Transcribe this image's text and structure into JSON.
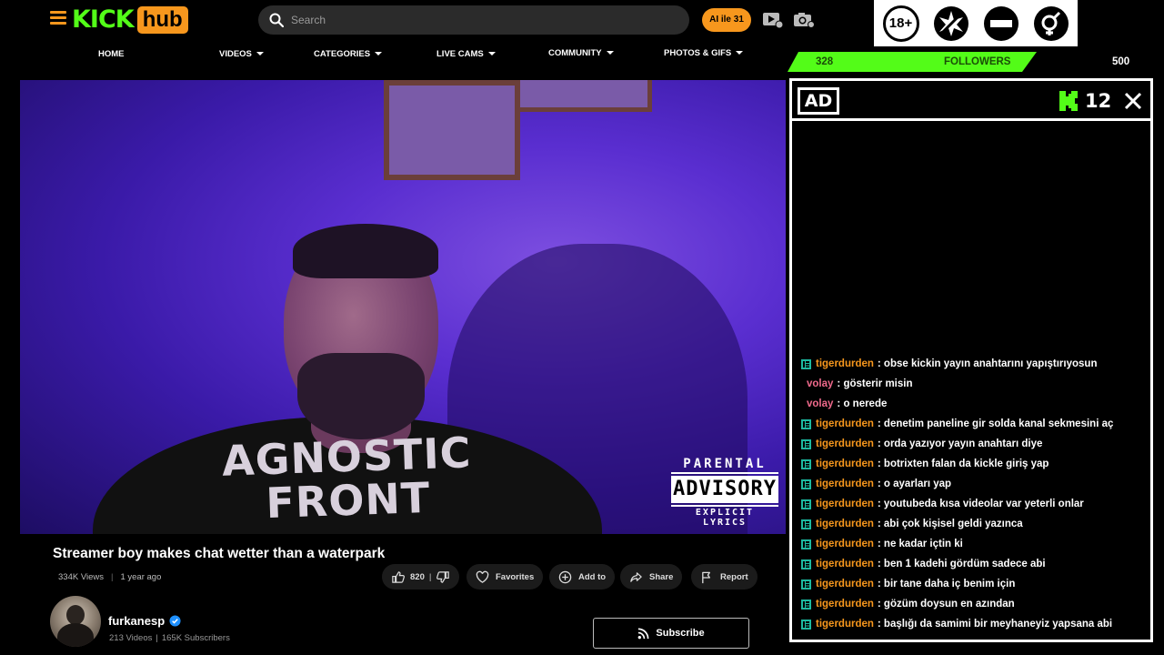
{
  "header": {
    "logo_kick": "KICK",
    "logo_hub": "hub",
    "search_placeholder": "Search",
    "ai_button": "AI ile 31",
    "icons": [
      "menu-icon",
      "search-icon",
      "video-camera-icon",
      "photo-camera-icon"
    ],
    "badges": [
      "18+",
      "explicit-star-badge-icon",
      "no-entry-badge-icon",
      "gender-badge-icon"
    ]
  },
  "nav": {
    "items": [
      {
        "label": "HOME",
        "dropdown": false
      },
      {
        "label": "VIDEOS",
        "dropdown": true
      },
      {
        "label": "CATEGORIES",
        "dropdown": true
      },
      {
        "label": "LIVE CAMS",
        "dropdown": true
      },
      {
        "label": "COMMUNITY",
        "dropdown": true
      },
      {
        "label": "PHOTOS & GIFS",
        "dropdown": true
      }
    ]
  },
  "followers": {
    "current": "328",
    "label": "FOLLOWERS",
    "goal": "500",
    "progress": 0.656
  },
  "video": {
    "shirt_text": "AGNOSTIC FRONT",
    "advisory": {
      "line1": "PARENTAL",
      "line2": "ADVISORY",
      "line3": "EXPLICIT LYRICS"
    },
    "title": "Streamer boy makes chat wetter than a waterpark",
    "views": "334K Views",
    "age": "1 year ago",
    "likes": "820",
    "actions": {
      "favorites": "Favorites",
      "add_to": "Add to",
      "share": "Share",
      "report": "Report"
    }
  },
  "channel": {
    "name": "furkanesp",
    "videos": "213 Videos",
    "subscribers": "165K Subscribers",
    "subscribe_label": "Subscribe"
  },
  "chat": {
    "ad_label": "AD",
    "count": "12",
    "messages": [
      {
        "user": "tigerdurden",
        "badge": true,
        "text": ": obse kickin yayın anahtarını yapıştırıyosun"
      },
      {
        "user": "volay",
        "badge": false,
        "text": ": gösterir misin"
      },
      {
        "user": "volay",
        "badge": false,
        "text": ": o nerede"
      },
      {
        "user": "tigerdurden",
        "badge": true,
        "text": ": denetim paneline gir solda kanal sekmesini aç"
      },
      {
        "user": "tigerdurden",
        "badge": true,
        "text": ": orda yazıyor yayın anahtarı diye"
      },
      {
        "user": "tigerdurden",
        "badge": true,
        "text": ": botrixten falan da kickle giriş yap"
      },
      {
        "user": "tigerdurden",
        "badge": true,
        "text": ": o ayarları yap"
      },
      {
        "user": "tigerdurden",
        "badge": true,
        "text": ": youtubeda kısa videolar var yeterli onlar"
      },
      {
        "user": "tigerdurden",
        "badge": true,
        "text": ": abi çok kişisel geldi yazınca"
      },
      {
        "user": "tigerdurden",
        "badge": true,
        "text": ": ne kadar içtin ki"
      },
      {
        "user": "tigerdurden",
        "badge": true,
        "text": ": ben 1 kadehi gördüm sadece abi"
      },
      {
        "user": "tigerdurden",
        "badge": true,
        "text": ": bir tane daha iç benim için"
      },
      {
        "user": "tigerdurden",
        "badge": true,
        "text": ": gözüm doysun en azından"
      },
      {
        "user": "tigerdurden",
        "badge": true,
        "text": ": başlığı da samimi bir meyhaneyiz yapsana abi"
      }
    ]
  },
  "colors": {
    "kick_green": "#53fc18",
    "hub_orange": "#f7971d",
    "background": "#000000"
  }
}
